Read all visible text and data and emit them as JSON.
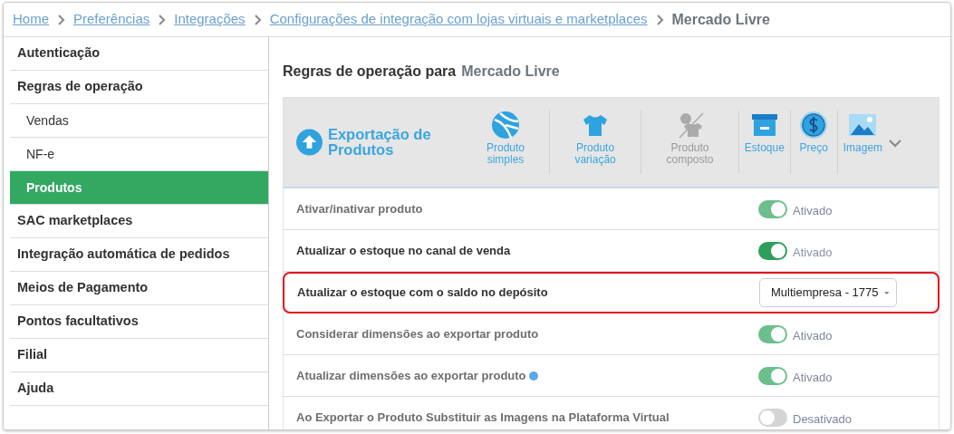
{
  "breadcrumb": [
    {
      "label": "Home",
      "kind": "link"
    },
    {
      "label": "Preferências",
      "kind": "link"
    },
    {
      "label": "Integrações",
      "kind": "link"
    },
    {
      "label": "Configurações de integração com lojas virtuais e marketplaces",
      "kind": "link"
    },
    {
      "label": "Mercado Livre",
      "kind": "current"
    }
  ],
  "sidebar": {
    "items": [
      {
        "label": "Autenticação",
        "selected": false
      },
      {
        "label": "Regras de operação",
        "selected": false,
        "children": [
          {
            "label": "Vendas",
            "selected": false
          },
          {
            "label": "NF-e",
            "selected": false
          },
          {
            "label": "Produtos",
            "selected": true
          }
        ]
      },
      {
        "label": "SAC marketplaces",
        "selected": false
      },
      {
        "label": "Integração automática de pedidos",
        "selected": false
      },
      {
        "label": "Meios de Pagamento",
        "selected": false
      },
      {
        "label": "Pontos facultativos",
        "selected": false
      },
      {
        "label": "Filial",
        "selected": false
      },
      {
        "label": "Ajuda",
        "selected": false
      }
    ]
  },
  "page_title": {
    "text": "Regras de operação para",
    "name": "Mercado Livre"
  },
  "section": {
    "title": "Exportação de Produtos",
    "expanded": false,
    "tabs": [
      {
        "label": "Produto simples",
        "disabled": false
      },
      {
        "label": "Produto variação",
        "disabled": false
      },
      {
        "label": "Produto composto",
        "disabled": true
      },
      {
        "label": "Estoque",
        "disabled": false
      },
      {
        "label": "Preço",
        "disabled": false
      },
      {
        "label": "Imagem",
        "disabled": false
      }
    ]
  },
  "rows": [
    {
      "kind": "toggle",
      "label": "Ativar/inativar produto",
      "on": true,
      "status": "Ativado",
      "dimmed": true,
      "highlighted": false,
      "info": false
    },
    {
      "kind": "toggle",
      "label": "Atualizar o estoque no canal de venda",
      "on": true,
      "status": "Ativado",
      "dimmed": false,
      "highlighted": false,
      "info": false
    },
    {
      "kind": "select",
      "label": "Atualizar o estoque com o saldo no depósito",
      "value": "Multiempresa - 1775",
      "dimmed": false,
      "highlighted": true,
      "info": false
    },
    {
      "kind": "toggle",
      "label": "Considerar dimensões ao exportar produto",
      "on": true,
      "status": "Ativado",
      "dimmed": true,
      "highlighted": false,
      "info": false
    },
    {
      "kind": "toggle",
      "label": "Atualizar dimensões ao exportar produto",
      "info": true,
      "on": true,
      "status": "Ativado",
      "dimmed": true,
      "highlighted": false
    },
    {
      "kind": "toggle",
      "label": "Ao Exportar o Produto Substituir as Imagens na Plataforma Virtual",
      "on": false,
      "status": "Desativado",
      "dimmed": true,
      "highlighted": false,
      "info": false
    }
  ]
}
